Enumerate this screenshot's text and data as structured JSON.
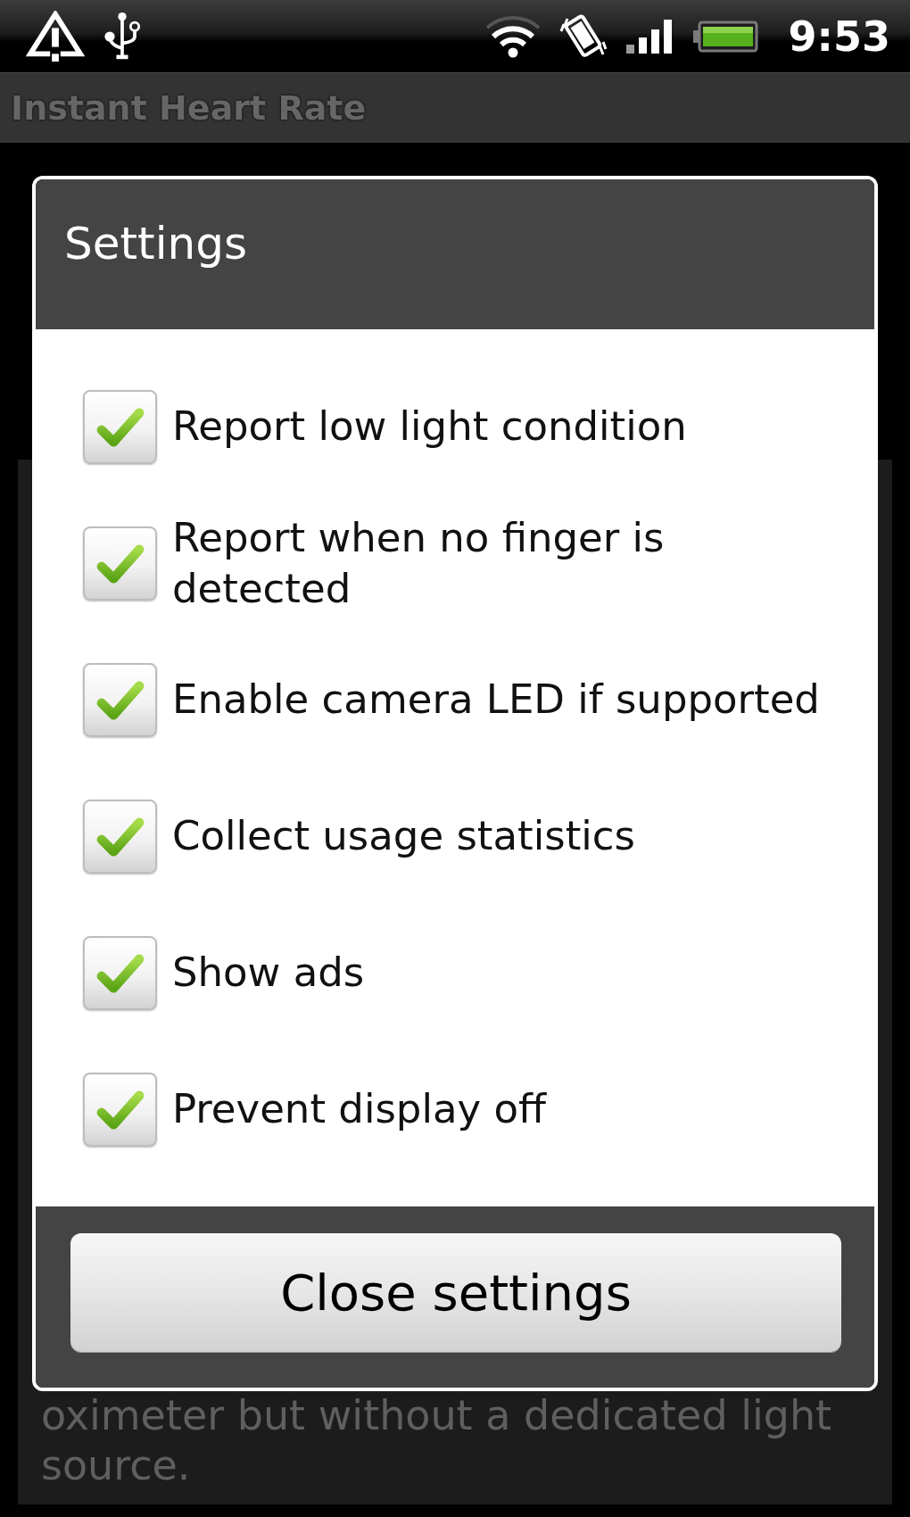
{
  "status_bar": {
    "time": "9:53"
  },
  "app_bar": {
    "title": "Instant Heart Rate"
  },
  "dialog": {
    "title": "Settings",
    "options": [
      {
        "label": "Report low light condition",
        "checked": true
      },
      {
        "label": "Report when no finger is detected",
        "checked": true
      },
      {
        "label": "Enable camera LED if supported",
        "checked": true
      },
      {
        "label": "Collect usage statistics",
        "checked": true
      },
      {
        "label": "Show ads",
        "checked": true
      },
      {
        "label": "Prevent display off",
        "checked": true
      }
    ],
    "button": "Close settings"
  },
  "background_text": [
    "oximeter but without a dedicated light",
    "source."
  ]
}
